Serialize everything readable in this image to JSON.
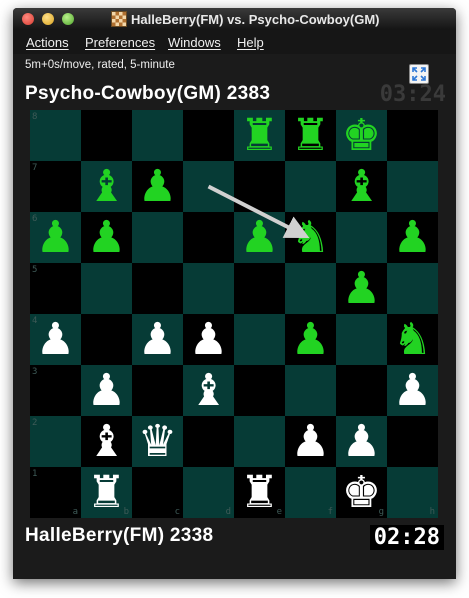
{
  "window": {
    "title": "HalleBerry(FM) vs. Psycho-Cowboy(GM)"
  },
  "menu": {
    "actions": "Actions",
    "preferences": "Preferences",
    "windows": "Windows",
    "help": "Help"
  },
  "game": {
    "info": "5m+0s/move, rated, 5-minute",
    "expand_icon": "expand-arrows-icon"
  },
  "top_player": {
    "name_rating": "Psycho-Cowboy(GM) 2383",
    "clock": "03:24"
  },
  "bottom_player": {
    "name_rating": "HalleBerry(FM) 2338",
    "clock": "02:28"
  },
  "colors": {
    "light_square": "#063b36",
    "dark_square": "#000000",
    "black_pieces": "#22d322",
    "white_pieces": "#ffffff",
    "arrow": "#d0d0d0"
  },
  "board": {
    "rank_labels": [
      "8",
      "7",
      "6",
      "5",
      "4",
      "3",
      "2",
      "1"
    ],
    "file_labels": [
      "a",
      "b",
      "c",
      "d",
      "e",
      "f",
      "g",
      "h"
    ],
    "rows": [
      [
        "",
        "",
        "",
        "",
        "♜g",
        "♜g",
        "♚g",
        ""
      ],
      [
        "",
        "♝g",
        "♟g",
        "",
        "",
        "",
        "♝g",
        ""
      ],
      [
        "♟g",
        "♟g",
        "",
        "",
        "♟g",
        "♞g",
        "",
        "♟g"
      ],
      [
        "",
        "",
        "",
        "",
        "",
        "",
        "♟g",
        ""
      ],
      [
        "♟w",
        "",
        "♟w",
        "♟w",
        "",
        "♟g",
        "",
        "♞g"
      ],
      [
        "",
        "♟w",
        "",
        "♝w",
        "",
        "",
        "",
        "♟w"
      ],
      [
        "",
        "♝w",
        "♛w",
        "",
        "",
        "♟w",
        "♟w",
        ""
      ],
      [
        "",
        "♜w",
        "",
        "",
        "♜w",
        "",
        "♚w",
        ""
      ]
    ],
    "last_move": {
      "from": "d7",
      "to": "f6"
    }
  }
}
